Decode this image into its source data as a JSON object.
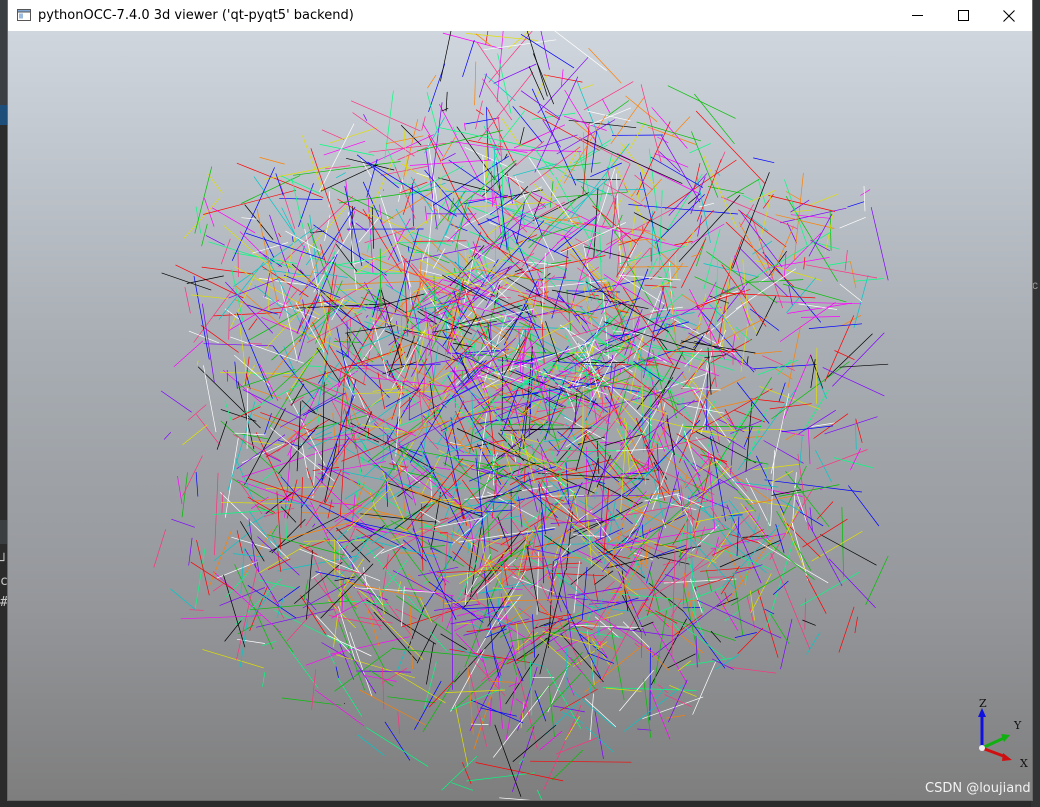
{
  "window": {
    "title": "pythonOCC-7.4.0 3d viewer ('qt-pyqt5' backend)",
    "controls": {
      "minimize": "minimize",
      "maximize": "maximize",
      "close": "close"
    }
  },
  "viewport": {
    "background_top": "#d0d6de",
    "background_bottom": "#7e7e7e",
    "shape": "cube of random colored line segments",
    "trihedron": {
      "z_label": "Z",
      "y_label": "Y",
      "x_label": "X"
    }
  },
  "watermark": "CSDN @loujiand",
  "background_app": {
    "snippets": [
      "┘",
      "c",
      "#"
    ],
    "right_hint": "c"
  }
}
